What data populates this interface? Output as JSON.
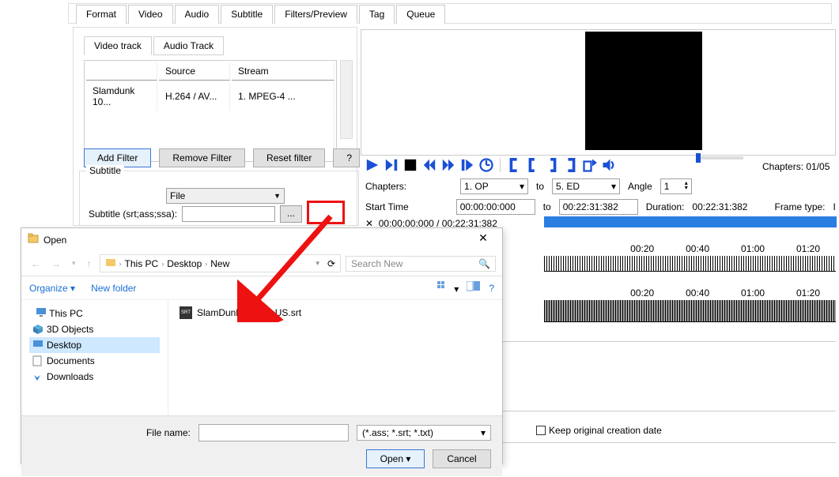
{
  "tabs": {
    "main": [
      "Format",
      "Video",
      "Audio",
      "Subtitle",
      "Filters/Preview",
      "Tag",
      "Queue"
    ],
    "activeMain": 4,
    "sub": [
      "Video track",
      "Audio Track"
    ],
    "activeSub": 0
  },
  "track_table": {
    "headers": [
      "",
      "Source",
      "Stream"
    ],
    "row": {
      "name": "Slamdunk 10...",
      "source": "H.264 / AV...",
      "stream": "1. MPEG-4 ..."
    }
  },
  "filter_buttons": {
    "add": "Add Filter",
    "remove": "Remove Filter",
    "reset": "Reset filter",
    "help": "?"
  },
  "subtitle": {
    "legend": "Subtitle",
    "type_selected": "File",
    "label": "Subtitle (srt;ass;ssa):",
    "value": "",
    "browse": "..."
  },
  "playback": {
    "chapters_label": "Chapters:",
    "to": "to",
    "chapter_from": "1. OP",
    "chapter_to": "5. ED",
    "angle_label": "Angle",
    "angle": "1",
    "start_label": "Start Time",
    "start": "00:00:00:000",
    "end": "00:22:31:382",
    "duration_label": "Duration:",
    "duration": "00:22:31:382",
    "frametype_label": "Frame type:",
    "frametype": "I",
    "pos": "00:00:00:000 / 00:22:31:382",
    "chapters_right": "Chapters: 01/05"
  },
  "timeline_labels": [
    "00:20",
    "00:40",
    "01:00",
    "01:20"
  ],
  "keep_original": "Keep original creation date",
  "dialog": {
    "title": "Open",
    "breadcrumb": [
      "This PC",
      "Desktop",
      "New"
    ],
    "search_placeholder": "Search New",
    "organize": "Organize",
    "newfolder": "New folder",
    "tree": [
      {
        "label": "This PC",
        "type": "root"
      },
      {
        "label": "3D Objects",
        "type": "folder3d"
      },
      {
        "label": "Desktop",
        "type": "desktop",
        "selected": true
      },
      {
        "label": "Documents",
        "type": "docs"
      },
      {
        "label": "Downloads",
        "type": "downloads"
      }
    ],
    "file": "SlamDunk101.en_US.srt",
    "filename_label": "File name:",
    "filename_value": "",
    "filter": "(*.ass; *.srt; *.txt)",
    "open": "Open",
    "cancel": "Cancel"
  }
}
